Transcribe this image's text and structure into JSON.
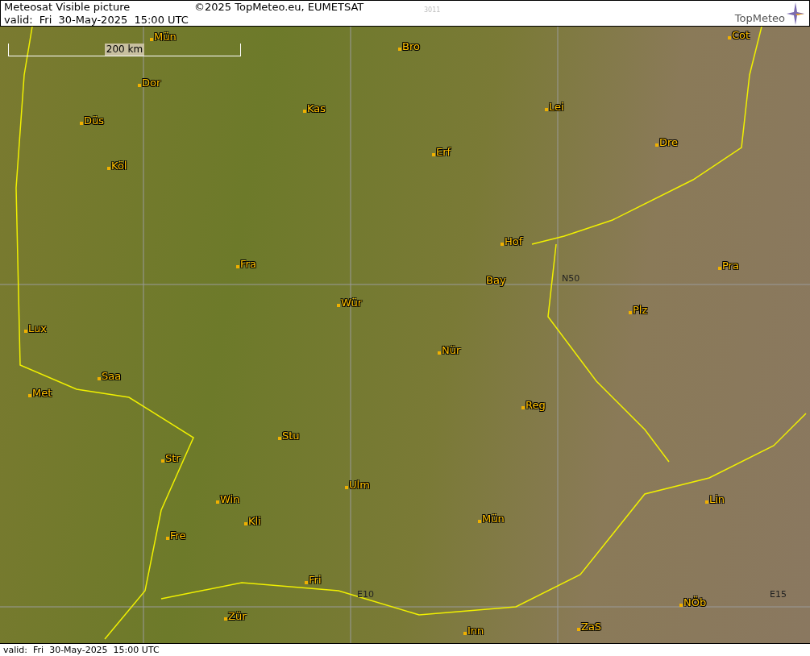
{
  "header": {
    "title": "Meteosat Visible picture",
    "valid": "valid:  Fri  30-May-2025  15:00 UTC",
    "copyright": "©2025 TopMeteo.eu, EUMETSAT",
    "code": "3011",
    "logo": "TopMeteo"
  },
  "map": {
    "scale": "200 km",
    "grid_labels": [
      "N50",
      "E10",
      "E15"
    ],
    "cities": [
      {
        "name": "Mün",
        "dot": true
      },
      {
        "name": "Bro",
        "dot": true
      },
      {
        "name": "Cot",
        "dot": true
      },
      {
        "name": "Dor",
        "dot": true
      },
      {
        "name": "Kas",
        "dot": true
      },
      {
        "name": "Lei",
        "dot": true
      },
      {
        "name": "Düs",
        "dot": true
      },
      {
        "name": "Erf",
        "dot": true
      },
      {
        "name": "Dre",
        "dot": true
      },
      {
        "name": "Köl",
        "dot": true
      },
      {
        "name": "Hof",
        "dot": true
      },
      {
        "name": "Fra",
        "dot": true
      },
      {
        "name": "Bay",
        "dot": false
      },
      {
        "name": "Pra",
        "dot": true
      },
      {
        "name": "Wür",
        "dot": true
      },
      {
        "name": "Plz",
        "dot": true
      },
      {
        "name": "Lux",
        "dot": true
      },
      {
        "name": "Nür",
        "dot": true
      },
      {
        "name": "Saa",
        "dot": true
      },
      {
        "name": "Met",
        "dot": true
      },
      {
        "name": "Reg",
        "dot": true
      },
      {
        "name": "Stu",
        "dot": true
      },
      {
        "name": "Str",
        "dot": true
      },
      {
        "name": "Ulm",
        "dot": true
      },
      {
        "name": "Win",
        "dot": true
      },
      {
        "name": "Lin",
        "dot": true
      },
      {
        "name": "Kli",
        "dot": true
      },
      {
        "name": "Mün",
        "dot": true
      },
      {
        "name": "Fre",
        "dot": true
      },
      {
        "name": "Fri",
        "dot": true
      },
      {
        "name": "NÖb",
        "dot": true
      },
      {
        "name": "Zür",
        "dot": true
      },
      {
        "name": "Inn",
        "dot": true
      },
      {
        "name": "ZaS",
        "dot": true
      }
    ]
  },
  "footer": {
    "valid": "valid:  Fri  30-May-2025  15:00 UTC"
  }
}
